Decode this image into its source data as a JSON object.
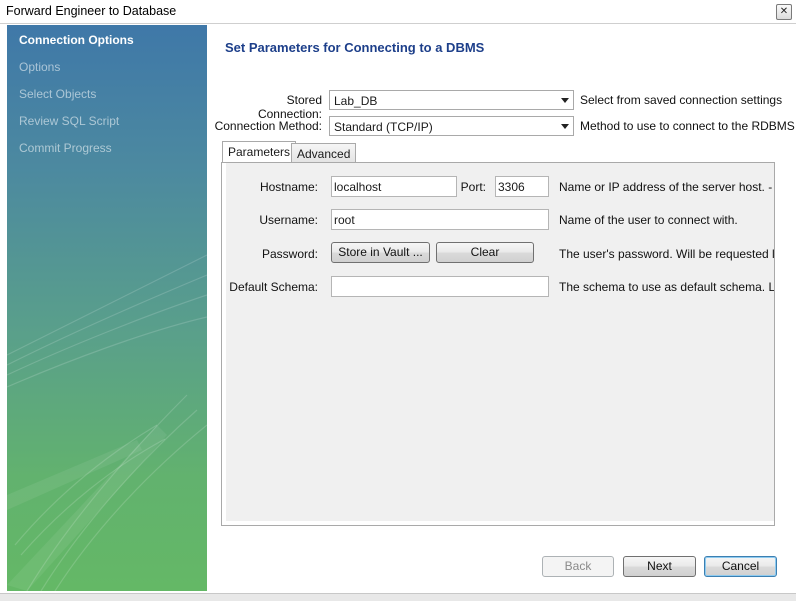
{
  "window": {
    "title": "Forward Engineer to Database",
    "close_glyph": "✕"
  },
  "sidebar": {
    "steps": [
      {
        "label": "Connection Options",
        "active": true
      },
      {
        "label": "Options",
        "active": false
      },
      {
        "label": "Select Objects",
        "active": false
      },
      {
        "label": "Review SQL Script",
        "active": false
      },
      {
        "label": "Commit Progress",
        "active": false
      }
    ]
  },
  "main": {
    "heading": "Set Parameters for Connecting to a DBMS",
    "stored_connection": {
      "label": "Stored Connection:",
      "value": "Lab_DB",
      "hint": "Select from saved connection settings"
    },
    "connection_method": {
      "label": "Connection Method:",
      "value": "Standard (TCP/IP)",
      "hint": "Method to use to connect to the RDBMS"
    },
    "tabs": [
      {
        "label": "Parameters",
        "active": true
      },
      {
        "label": "Advanced",
        "active": false
      }
    ],
    "params": {
      "hostname": {
        "label": "Hostname:",
        "value": "localhost",
        "hint": "Name or IP address of the server host. - TCP"
      },
      "port": {
        "label": "Port:",
        "value": "3306"
      },
      "username": {
        "label": "Username:",
        "value": "root",
        "hint": "Name of the user to connect with."
      },
      "password": {
        "label": "Password:",
        "store_button": "Store in Vault ...",
        "clear_button": "Clear",
        "hint": "The user's password. Will be requested later"
      },
      "default_schema": {
        "label": "Default Schema:",
        "value": "",
        "hint": "The schema to use as default schema. Leave"
      }
    }
  },
  "footer": {
    "back": "Back",
    "next": "Next",
    "cancel": "Cancel"
  },
  "colors": {
    "heading": "#1d3f8a",
    "sidebar_top": "#3f78a8",
    "sidebar_bottom": "#64b866"
  }
}
